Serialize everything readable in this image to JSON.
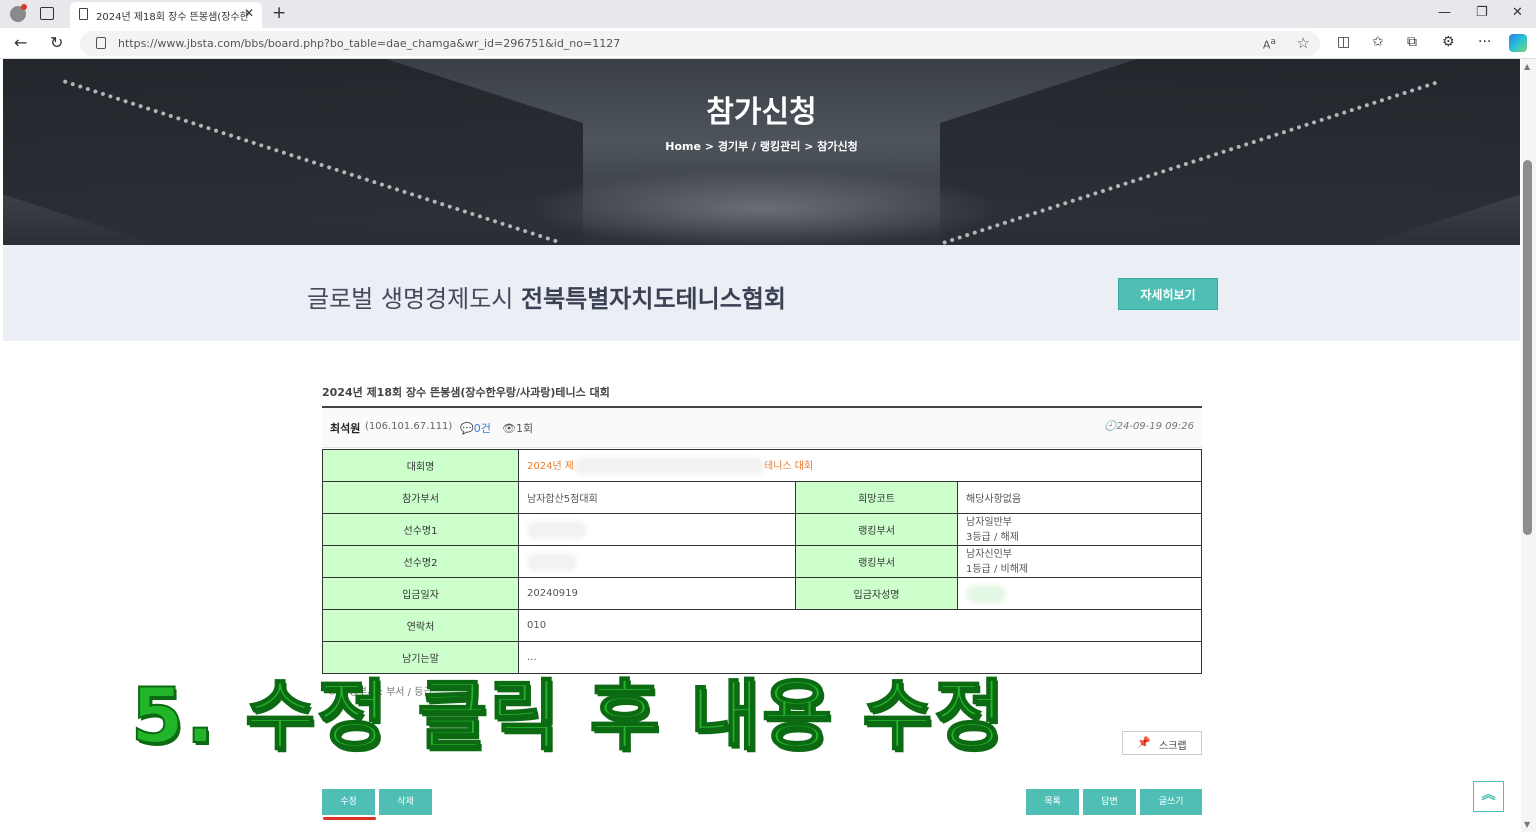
{
  "browser": {
    "tab_title": "2024년 제18회 장수 뜬봉샘(장수한",
    "tab_close": "✕",
    "new_tab": "+",
    "url": "https://www.jbsta.com/bbs/board.php?bo_table=dae_chamga&wr_id=296751&id_no=1127",
    "window_minimize": "—",
    "window_restore": "❐",
    "window_close": "✕"
  },
  "hero": {
    "title": "참가신청",
    "breadcrumb": "Home > 경기부 / 랭킹관리 > 참가신청"
  },
  "banner": {
    "text_light": "글로벌 생명경제도시 ",
    "text_bold": "전북특별자치도테니스협회",
    "detail_button": "자세히보기"
  },
  "post": {
    "title": "2024년 제18회 장수 뜬봉샘(장수한우랑/사과랑)테니스 대회",
    "author": "최석원",
    "ip": "(106.101.67.111)",
    "comments": "💬0건",
    "views": "👁1회",
    "date": "🕘24-09-19 09:26"
  },
  "form": {
    "rows": [
      {
        "label": "대회명",
        "value_start": "2024년 제",
        "value_end": "테니스 대회"
      },
      {
        "label": "참가부서",
        "value": "남자합산5점대회",
        "label2": "희망코트",
        "value2": "해당사항없음"
      },
      {
        "label": "선수명1",
        "value": "",
        "label2": "랭킹부서",
        "value2_line1": "남자일반부",
        "value2_line2": "3등급 / 해제"
      },
      {
        "label": "선수명2",
        "value": "",
        "label2": "랭킹부서",
        "value2_line1": "남자신인부",
        "value2_line2": "1등급 / 비해제"
      },
      {
        "label": "입금일자",
        "value": "20240919",
        "label2": "입금자성명",
        "value2": ""
      },
      {
        "label": "연락처",
        "value": "010"
      },
      {
        "label": "남기는말",
        "value": "..."
      }
    ]
  },
  "note": "※ 랭킹부서 : 부서 / 등급",
  "caption": "5. 수정 클릭 후 내용 수정",
  "buttons": {
    "scrap": "스크랩",
    "edit": "수정",
    "delete": "삭제",
    "list": "목록",
    "reply": "답변",
    "write": "글쓰기",
    "top": "︽"
  },
  "colors": {
    "accent": "#4fbfb5",
    "label_bg": "#ccffcc",
    "caption": "#22b52a",
    "underline": "#e0302a"
  }
}
